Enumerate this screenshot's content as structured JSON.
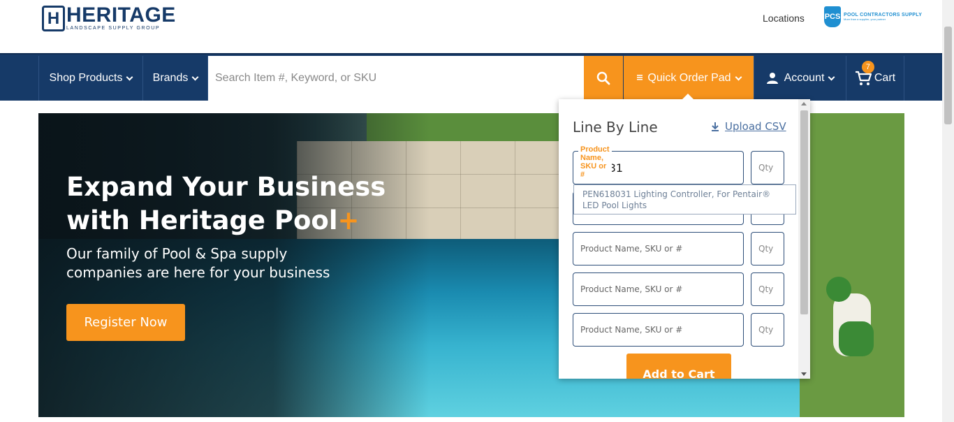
{
  "header": {
    "logo_name": "HERITAGE",
    "logo_sub": "LANDSCAPE SUPPLY GROUP",
    "logo_mark": "H",
    "locations": "Locations",
    "partner_badge": "PCS",
    "partner_name": "POOL CONTRACTORS SUPPLY",
    "partner_tagline": "More than a supplier, your partner"
  },
  "nav": {
    "shop_products": "Shop Products",
    "brands": "Brands",
    "search_placeholder": "Search Item #, Keyword, or SKU",
    "quick_order_pad": "Quick Order Pad",
    "account": "Account",
    "cart": "Cart",
    "cart_count": "7"
  },
  "hero": {
    "title_line1": "Expand Your Business",
    "title_line2": "with Heritage Pool",
    "title_plus": "+",
    "subtitle": "Our family of Pool & Spa supply companies  are here for your business",
    "register_button": "Register Now"
  },
  "quick_order": {
    "title": "Line By Line",
    "upload_label": "Upload CSV",
    "active_label": "Product Name, SKU or #",
    "active_value": "618031",
    "product_placeholder": "Product Name, SKU or #",
    "qty_placeholder": "Qty",
    "suggestion": "PEN618031 Lighting Controller, For Pentair® LED Pool Lights",
    "add_to_cart": "Add to Cart"
  },
  "colors": {
    "navy": "#163a68",
    "orange": "#f7941d"
  }
}
